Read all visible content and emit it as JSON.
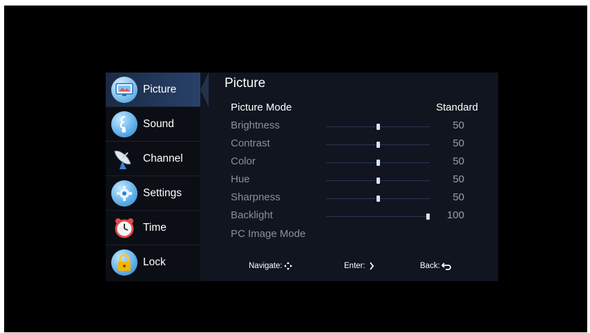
{
  "sidebar": {
    "items": [
      {
        "label": "Picture",
        "icon": "picture-icon",
        "active": true
      },
      {
        "label": "Sound",
        "icon": "music-note-icon",
        "active": false
      },
      {
        "label": "Channel",
        "icon": "satellite-dish-icon",
        "active": false
      },
      {
        "label": "Settings",
        "icon": "gear-icon",
        "active": false
      },
      {
        "label": "Time",
        "icon": "alarm-clock-icon",
        "active": false
      },
      {
        "label": "Lock",
        "icon": "padlock-icon",
        "active": false
      }
    ]
  },
  "main": {
    "title": "Picture",
    "picture_mode": {
      "label": "Picture Mode",
      "value": "Standard"
    },
    "settings": [
      {
        "label": "Brightness",
        "value": "50",
        "level": 50
      },
      {
        "label": "Contrast",
        "value": "50",
        "level": 50
      },
      {
        "label": "Color",
        "value": "50",
        "level": 50
      },
      {
        "label": "Hue",
        "value": "50",
        "level": 50
      },
      {
        "label": "Sharpness",
        "value": "50",
        "level": 50
      },
      {
        "label": "Backlight",
        "value": "100",
        "level": 100
      }
    ],
    "pc_image_mode": {
      "label": "PC Image Mode"
    }
  },
  "footer": {
    "navigate": "Navigate:",
    "enter": "Enter:",
    "back": "Back:",
    "navigate_icon": "dpad-icon",
    "enter_icon": "right-arrow-icon",
    "back_icon": "return-arrow-icon"
  },
  "colors": {
    "screen_bg": "#000000",
    "panel_bg": "#101520",
    "active_item": "#28416a",
    "slider_knob": "#d9e4f5"
  }
}
